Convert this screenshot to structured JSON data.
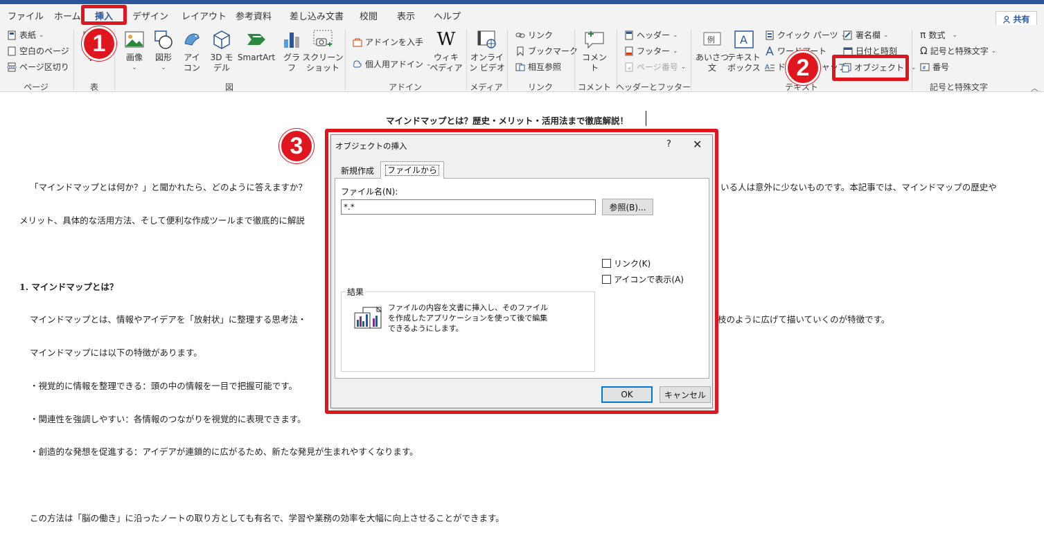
{
  "ribbon": {
    "tabs": [
      "ファイル",
      "ホーム",
      "挿入",
      "デザイン",
      "レイアウト",
      "参考資料",
      "差し込み文書",
      "校閲",
      "表示",
      "ヘルプ"
    ],
    "share_label": "共有",
    "groups": {
      "page": {
        "label": "ページ",
        "cover": "表紙",
        "blank": "空白のページ",
        "break": "ページ区切り"
      },
      "table": {
        "label": "表",
        "button": "表"
      },
      "illustrations": {
        "label": "図",
        "image": "画像",
        "shapes": "図形",
        "icons": "アイ\nコン",
        "model3d": "3D モ\nデル",
        "smartart": "SmartArt",
        "chart": "グラフ",
        "screenshot": "スクリーン\nショット"
      },
      "addins": {
        "label": "アドイン",
        "get": "アドインを入手",
        "personal": "個人用アドイン",
        "wiki": "ウィキ\nペディア"
      },
      "media": {
        "label": "メディア",
        "video": "オンライ\nン ビデオ"
      },
      "links": {
        "label": "リンク",
        "link": "リンク",
        "bookmark": "ブックマーク",
        "crossref": "相互参照"
      },
      "comments": {
        "label": "コメント",
        "comment": "コメント"
      },
      "headerfooter": {
        "label": "ヘッダーとフッター",
        "header": "ヘッダー",
        "footer": "フッター",
        "pagenum": "ページ番号"
      },
      "text": {
        "label": "テキスト",
        "greeting": "あいさつ\n文",
        "textbox": "テキスト\nボックス",
        "quickparts": "クイック パーツ",
        "wordart": "ワードアート",
        "dropcap": "ドロップ キャップ",
        "signature": "署名欄",
        "datetime": "日付と時刻",
        "object": "オブジェクト"
      },
      "symbols": {
        "label": "記号と特殊文字",
        "equation": "数式",
        "symbol": "記号と特殊文字",
        "number": "番号"
      }
    }
  },
  "annotations": {
    "badge1": "1",
    "badge2": "2",
    "badge3": "3"
  },
  "document": {
    "title": "マインドマップとは？歴史・メリット・活用法まで徹底解説！",
    "intro_line1_left": "「マインドマップとは何か？」と聞かれたら、どのように答えますか？",
    "intro_line1_right": "いる人は意外に少ないものです。本記事では、マインドマップの歴史や",
    "intro_line2_left": "メリット、具体的な活用方法、そして便利な作成ツールまで徹底的に解説",
    "heading1": "1. マインドマップとは？",
    "para1_left": "マインドマップとは、情報やアイデアを「放射状」に整理する思考法・",
    "para1_right": "枝のように広げて描いていくのが特徴です。",
    "para2": "マインドマップには以下の特徴があります。",
    "bullet1": "・視覚的に情報を整理できる：頭の中の情報を一目で把握可能です。",
    "bullet2": "・関連性を強調しやすい：各情報のつながりを視覚的に表現できます。",
    "bullet3": "・創造的な発想を促進する：アイデアが連鎖的に広がるため、新たな発見が生まれやすくなります。",
    "para3": "この方法は「脳の働き」に沿ったノートの取り方としても有名で、学習や業務の効率を大幅に向上させることができます。"
  },
  "dialog": {
    "title": "オブジェクトの挿入",
    "help": "?",
    "tab_new": "新規作成",
    "tab_file": "ファイルから",
    "filename_label": "ファイル名(N):",
    "filename_value": "*.*",
    "browse_button": "参照(B)...",
    "link_checkbox": "リンク(K)",
    "icon_checkbox": "アイコンで表示(A)",
    "result_label": "結果",
    "result_text": "ファイルの内容を文書に挿入し、そのファイルを作成したアプリケーションを使って後で編集できるようにします。",
    "ok_button": "OK",
    "cancel_button": "キャンセル"
  },
  "colors": {
    "accent": "#2b579a",
    "annotation_red": "#e0161e"
  }
}
